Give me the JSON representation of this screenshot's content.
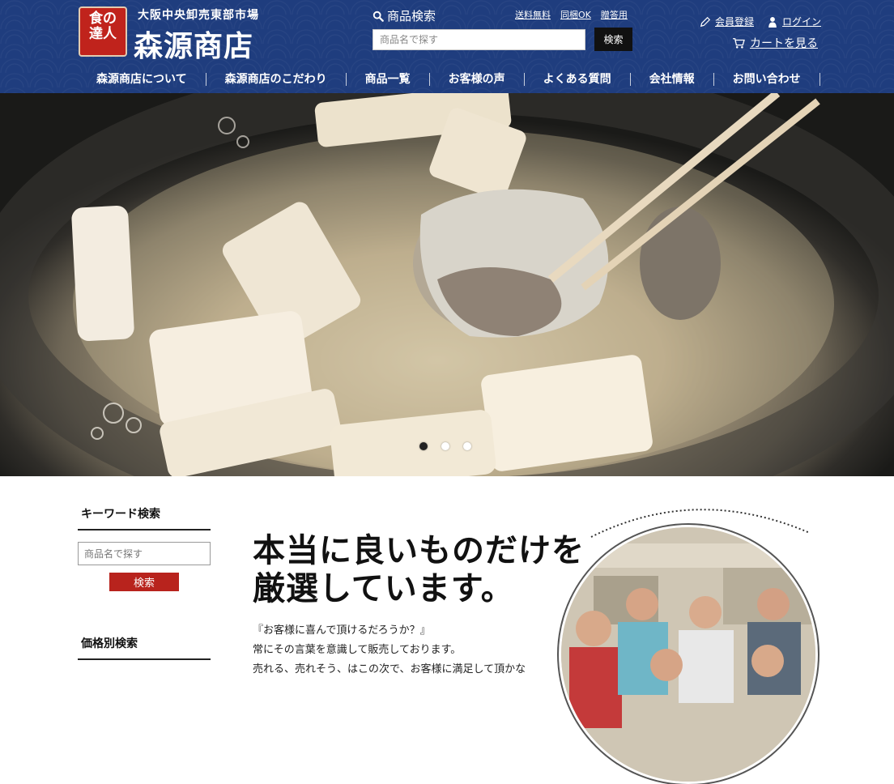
{
  "header": {
    "logo_seal": [
      "食の",
      "達人"
    ],
    "logo_sub": "大阪中央卸売東部市場",
    "logo_main": "森源商店",
    "search_heading": "商品検索",
    "toplinks": [
      "送料無料",
      "同梱OK",
      "贈答用"
    ],
    "search_placeholder": "商品名で探す",
    "search_button": "検索",
    "register": "会員登録",
    "login": "ログイン",
    "cart": "カートを見る"
  },
  "nav": [
    "森源商店について",
    "森源商店のこだわり",
    "商品一覧",
    "お客様の声",
    "よくある質問",
    "会社情報",
    "お問い合わせ"
  ],
  "slider": {
    "count": 3,
    "active": 1
  },
  "sidebar": {
    "keyword_title": "キーワード検索",
    "keyword_placeholder": "商品名で探す",
    "keyword_button": "検索",
    "price_title": "価格別検索"
  },
  "main": {
    "catch": "本当に良いものだけを\n厳選しています。",
    "body": "『お客様に喜んで頂けるだろうか？』\n常にその言葉を意識して販売しております。\n売れる、売れそう、はこの次で、お客様に満足して頂かな"
  }
}
